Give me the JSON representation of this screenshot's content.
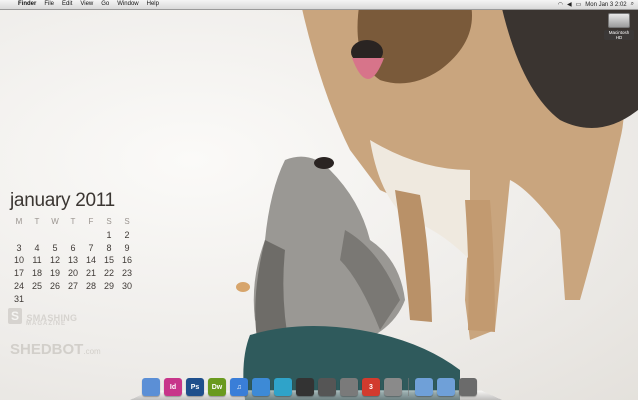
{
  "menubar": {
    "items": [
      "Finder",
      "File",
      "Edit",
      "View",
      "Go",
      "Window",
      "Help"
    ],
    "clock": "Mon Jan 3  2:02"
  },
  "desktop": {
    "drive_label": "Macintosh HD"
  },
  "calendar": {
    "title": "january 2011",
    "weekdays": [
      "M",
      "T",
      "W",
      "T",
      "F",
      "S",
      "S"
    ],
    "days": [
      "",
      "",
      "",
      "",
      "",
      "1",
      "2",
      "3",
      "4",
      "5",
      "6",
      "7",
      "8",
      "9",
      "10",
      "11",
      "12",
      "13",
      "14",
      "15",
      "16",
      "17",
      "18",
      "19",
      "20",
      "21",
      "22",
      "23",
      "24",
      "25",
      "26",
      "27",
      "28",
      "29",
      "30",
      "31",
      "",
      "",
      "",
      "",
      "",
      ""
    ]
  },
  "branding": {
    "smashing_line1": "SMASHING",
    "smashing_line2": "MAGAZINE",
    "shedbot": "SHEDBOT",
    "shedbot_suffix": ".com"
  },
  "dock": {
    "apps": [
      {
        "name": "finder-icon",
        "label": "",
        "color": "#5b8fd6"
      },
      {
        "name": "indesign-icon",
        "label": "Id",
        "color": "#c7358a"
      },
      {
        "name": "photoshop-icon",
        "label": "Ps",
        "color": "#1f4f8c"
      },
      {
        "name": "dreamweaver-icon",
        "label": "Dw",
        "color": "#6a9a1e"
      },
      {
        "name": "itunes-icon",
        "label": "♫",
        "color": "#3a7ed8"
      },
      {
        "name": "safari-icon",
        "label": "",
        "color": "#3d8ad6"
      },
      {
        "name": "messenger-icon",
        "label": "",
        "color": "#2fa3c9"
      },
      {
        "name": "media-icon",
        "label": "",
        "color": "#333333"
      },
      {
        "name": "terminal-icon",
        "label": "",
        "color": "#555555"
      },
      {
        "name": "system-preferences-icon",
        "label": "",
        "color": "#7a7a7a"
      },
      {
        "name": "calendar-icon",
        "label": "3",
        "color": "#d23b2e"
      },
      {
        "name": "preview-icon",
        "label": "",
        "color": "#8a8a8a"
      },
      {
        "name": "applications-folder-icon",
        "label": "",
        "color": "#6fa0d8"
      },
      {
        "name": "documents-folder-icon",
        "label": "",
        "color": "#6fa0d8"
      },
      {
        "name": "trash-icon",
        "label": "",
        "color": "#6b6b6b"
      }
    ]
  }
}
